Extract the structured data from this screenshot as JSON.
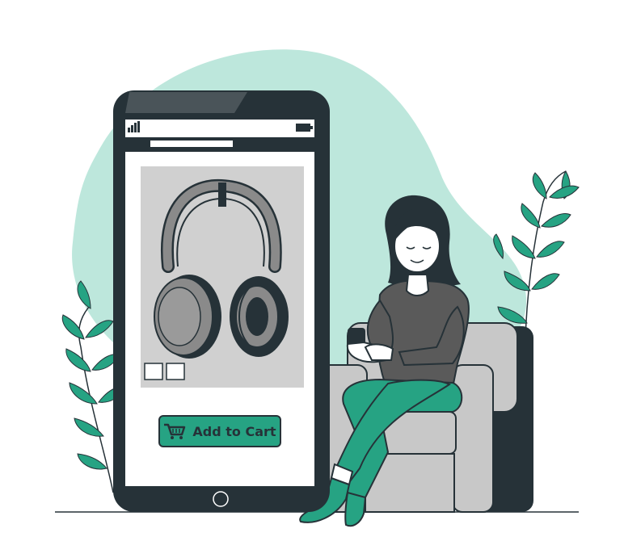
{
  "product": {
    "name": "headphones-product-image",
    "add_to_cart_label": "Add to Cart"
  },
  "phone": {
    "signal_icon": "signal-bars-icon",
    "battery_icon": "battery-icon",
    "cart_icon": "shopping-cart-icon",
    "home_icon": "home-button-icon"
  },
  "colors": {
    "accent": "#26a383",
    "dark": "#263238",
    "blob": "#bde7dc",
    "card": "#d0d0d0",
    "chair": "#c8c8c8"
  }
}
